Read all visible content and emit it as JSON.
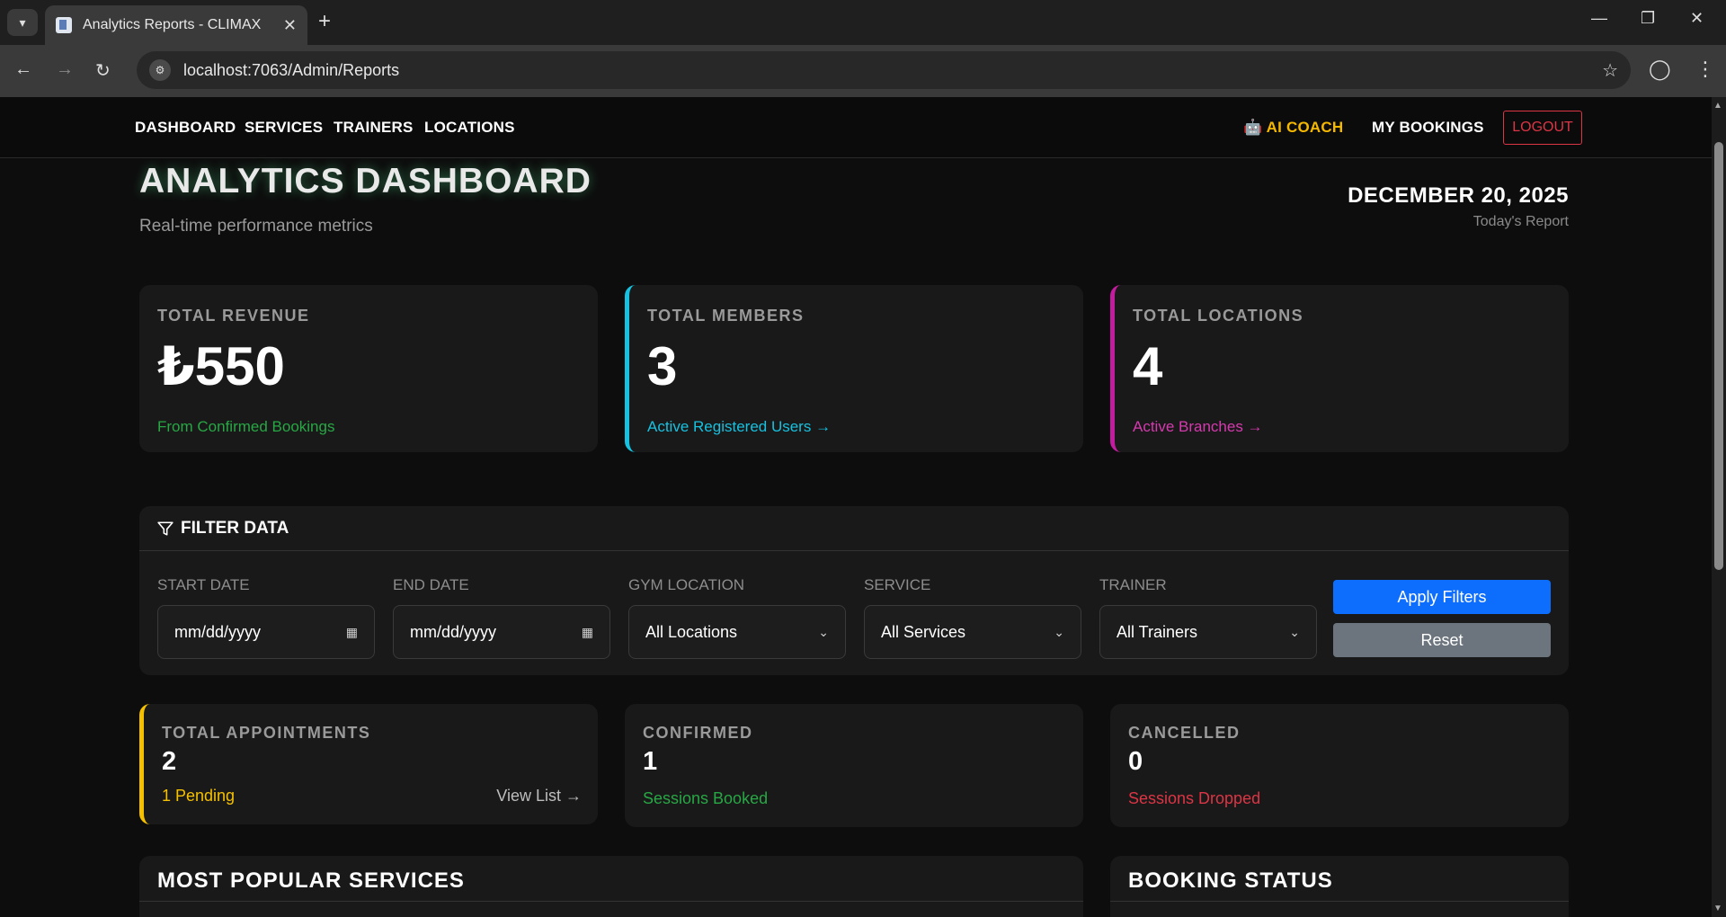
{
  "browser": {
    "tab_title": "Analytics Reports - CLIMAX",
    "url": "localhost:7063/Admin/Reports"
  },
  "nav": {
    "links": [
      "DASHBOARD",
      "SERVICES",
      "TRAINERS",
      "LOCATIONS"
    ],
    "ai_coach": "AI COACH",
    "my_bookings": "MY BOOKINGS",
    "logout": "LOGOUT"
  },
  "header": {
    "title": "ANALYTICS DASHBOARD",
    "subtitle": "Real-time performance metrics",
    "date": "DECEMBER 20, 2025",
    "date_caption": "Today's Report"
  },
  "stats": {
    "revenue": {
      "label": "TOTAL REVENUE",
      "value": "₺550",
      "foot": "From Confirmed Bookings",
      "foot_color": "#28a745"
    },
    "members": {
      "label": "TOTAL MEMBERS",
      "value": "3",
      "foot": "Active Registered Users →",
      "foot_color": "#17c1e0"
    },
    "locations": {
      "label": "TOTAL LOCATIONS",
      "value": "4",
      "foot": "Active Branches →",
      "foot_color": "#d63aaf"
    }
  },
  "filter": {
    "title": "FILTER DATA",
    "start_label": "START DATE",
    "start_value": "mm/dd/yyyy",
    "end_label": "END DATE",
    "end_value": "mm/dd/yyyy",
    "location_label": "GYM LOCATION",
    "location_value": "All Locations",
    "service_label": "SERVICE",
    "service_value": "All Services",
    "trainer_label": "TRAINER",
    "trainer_value": "All Trainers",
    "apply": "Apply Filters",
    "reset": "Reset"
  },
  "appointments": {
    "total": {
      "label": "TOTAL APPOINTMENTS",
      "value": "2",
      "foot": "1 Pending",
      "link": "View List →"
    },
    "confirmed": {
      "label": "CONFIRMED",
      "value": "1",
      "foot": "Sessions Booked"
    },
    "cancelled": {
      "label": "CANCELLED",
      "value": "0",
      "foot": "Sessions Dropped"
    }
  },
  "sections": {
    "popular": "MOST POPULAR SERVICES",
    "status": "BOOKING STATUS"
  },
  "colors": {
    "accent_cyan": "#17c1e0",
    "accent_magenta": "#c21c9f",
    "accent_yellow": "#f5c000",
    "success": "#28a745",
    "danger": "#dc3545",
    "primary": "#0d6efd"
  }
}
